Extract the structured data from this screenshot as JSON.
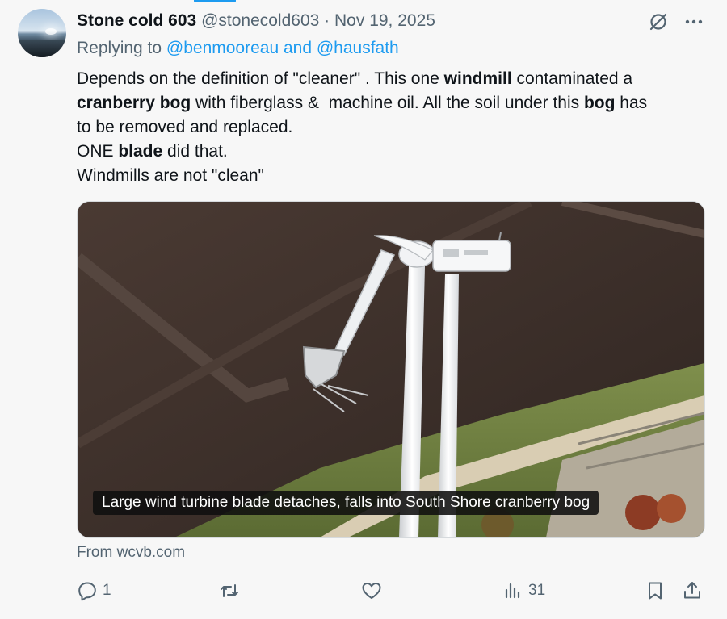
{
  "tweet": {
    "author_name": "Stone cold 603",
    "author_handle": "@stonecold603",
    "separator": "·",
    "date": "Nov 19, 2025",
    "replying_prefix": "Replying to",
    "replying_to": "@benmooreau and @hausfath",
    "body": {
      "l1_a": "Depends on the definition of \"cleaner\" . This one ",
      "l1_b": "windmill",
      "l1_c": " contaminated a",
      "l2_a": "cranberry bog",
      "l2_b": " with fiberglass &  machine oil. All the soil under this ",
      "l2_c": "bog",
      "l2_d": " has",
      "l3": "to be removed and replaced.",
      "l4_a": "ONE ",
      "l4_b": "blade",
      "l4_c": " did that.",
      "l5": "Windmills are not \"clean\""
    },
    "media_caption": "Large wind turbine blade detaches, falls into South Shore cranberry bog",
    "source": "From wcvb.com"
  },
  "actions": {
    "reply_count": "1",
    "repost_count": "",
    "like_count": "",
    "views_count": "31"
  },
  "icons": {
    "header": [
      "grok-icon",
      "more-icon"
    ],
    "actions": [
      "reply-icon",
      "repost-icon",
      "like-icon",
      "views-icon",
      "bookmark-icon",
      "share-icon"
    ]
  },
  "colors": {
    "link": "#1d9bf0",
    "muted": "#536471",
    "text": "#0f1419",
    "background": "#f7f7f7"
  }
}
